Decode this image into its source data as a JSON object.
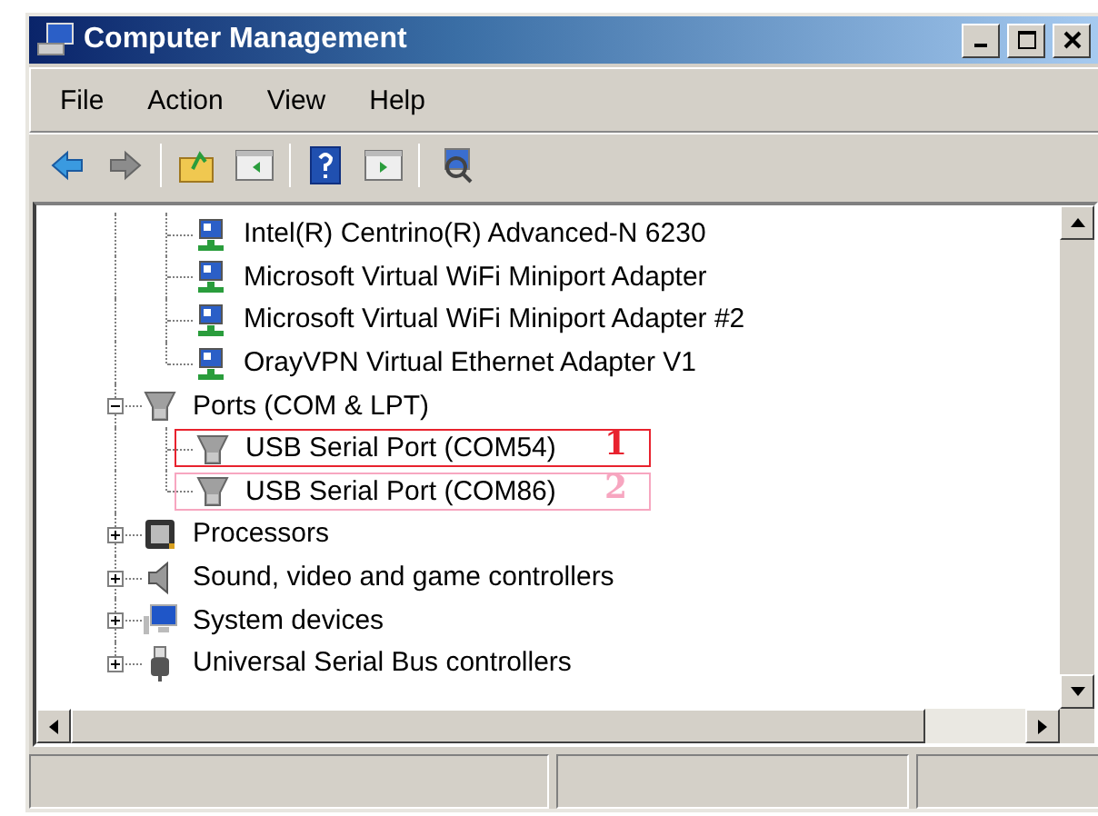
{
  "window": {
    "title": "Computer Management"
  },
  "menu": [
    "File",
    "Action",
    "View",
    "Help"
  ],
  "toolbar": [
    {
      "kind": "back",
      "disabled": false
    },
    {
      "kind": "forward",
      "disabled": true
    },
    {
      "kind": "separator"
    },
    {
      "kind": "up"
    },
    {
      "kind": "pane"
    },
    {
      "kind": "separator"
    },
    {
      "kind": "help"
    },
    {
      "kind": "action-pane"
    },
    {
      "kind": "separator"
    },
    {
      "kind": "scan"
    }
  ],
  "tree": {
    "continued_children": [
      {
        "label": "Intel(R) Centrino(R) Advanced-N 6230",
        "kind": "network"
      },
      {
        "label": "Microsoft Virtual WiFi Miniport Adapter",
        "kind": "network"
      },
      {
        "label": "Microsoft Virtual WiFi Miniport Adapter #2",
        "kind": "network"
      },
      {
        "label": "OrayVPN Virtual Ethernet Adapter V1",
        "kind": "network"
      }
    ],
    "items": [
      {
        "label": "Ports (COM & LPT)",
        "kind": "port",
        "expanded": true,
        "children": [
          {
            "label": "USB Serial Port (COM54)",
            "kind": "port",
            "highlight": {
              "number": "1",
              "color": "#e8222e"
            }
          },
          {
            "label": "USB Serial Port (COM86)",
            "kind": "port",
            "highlight": {
              "number": "2",
              "color": "#f7a6c0"
            }
          }
        ]
      },
      {
        "label": "Processors",
        "kind": "processor",
        "expanded": false
      },
      {
        "label": "Sound, video and game controllers",
        "kind": "sound",
        "expanded": false
      },
      {
        "label": "System devices",
        "kind": "system",
        "expanded": false
      },
      {
        "label": "Universal Serial Bus controllers",
        "kind": "usb",
        "expanded": false
      }
    ]
  }
}
